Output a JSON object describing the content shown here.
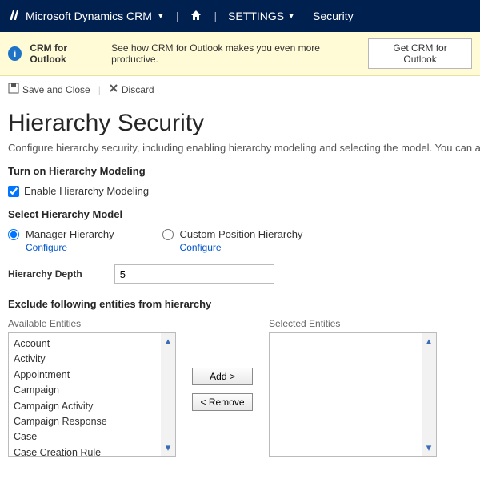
{
  "topnav": {
    "brand": "Microsoft Dynamics CRM",
    "settings": "SETTINGS",
    "breadcrumb": "Security"
  },
  "banner": {
    "title": "CRM for Outlook",
    "text": "See how CRM for Outlook makes you even more productive.",
    "button": "Get CRM for Outlook"
  },
  "toolbar": {
    "save": "Save and Close",
    "discard": "Discard"
  },
  "page": {
    "title": "Hierarchy Security",
    "desc": "Configure hierarchy security, including enabling hierarchy modeling and selecting the model. You can also specify h"
  },
  "turn_on_section": {
    "title": "Turn on Hierarchy Modeling",
    "checkbox_label": "Enable Hierarchy Modeling",
    "checked": true
  },
  "model_section": {
    "title": "Select Hierarchy Model",
    "options": [
      {
        "label": "Manager Hierarchy",
        "configure": "Configure",
        "selected": true
      },
      {
        "label": "Custom Position Hierarchy",
        "configure": "Configure",
        "selected": false
      }
    ]
  },
  "depth": {
    "label": "Hierarchy Depth",
    "value": "5"
  },
  "exclude": {
    "title": "Exclude following entities from hierarchy",
    "available_label": "Available Entities",
    "selected_label": "Selected Entities",
    "add": "Add >",
    "remove": "< Remove",
    "available": [
      "Account",
      "Activity",
      "Appointment",
      "Campaign",
      "Campaign Activity",
      "Campaign Response",
      "Case",
      "Case Creation Rule"
    ]
  }
}
